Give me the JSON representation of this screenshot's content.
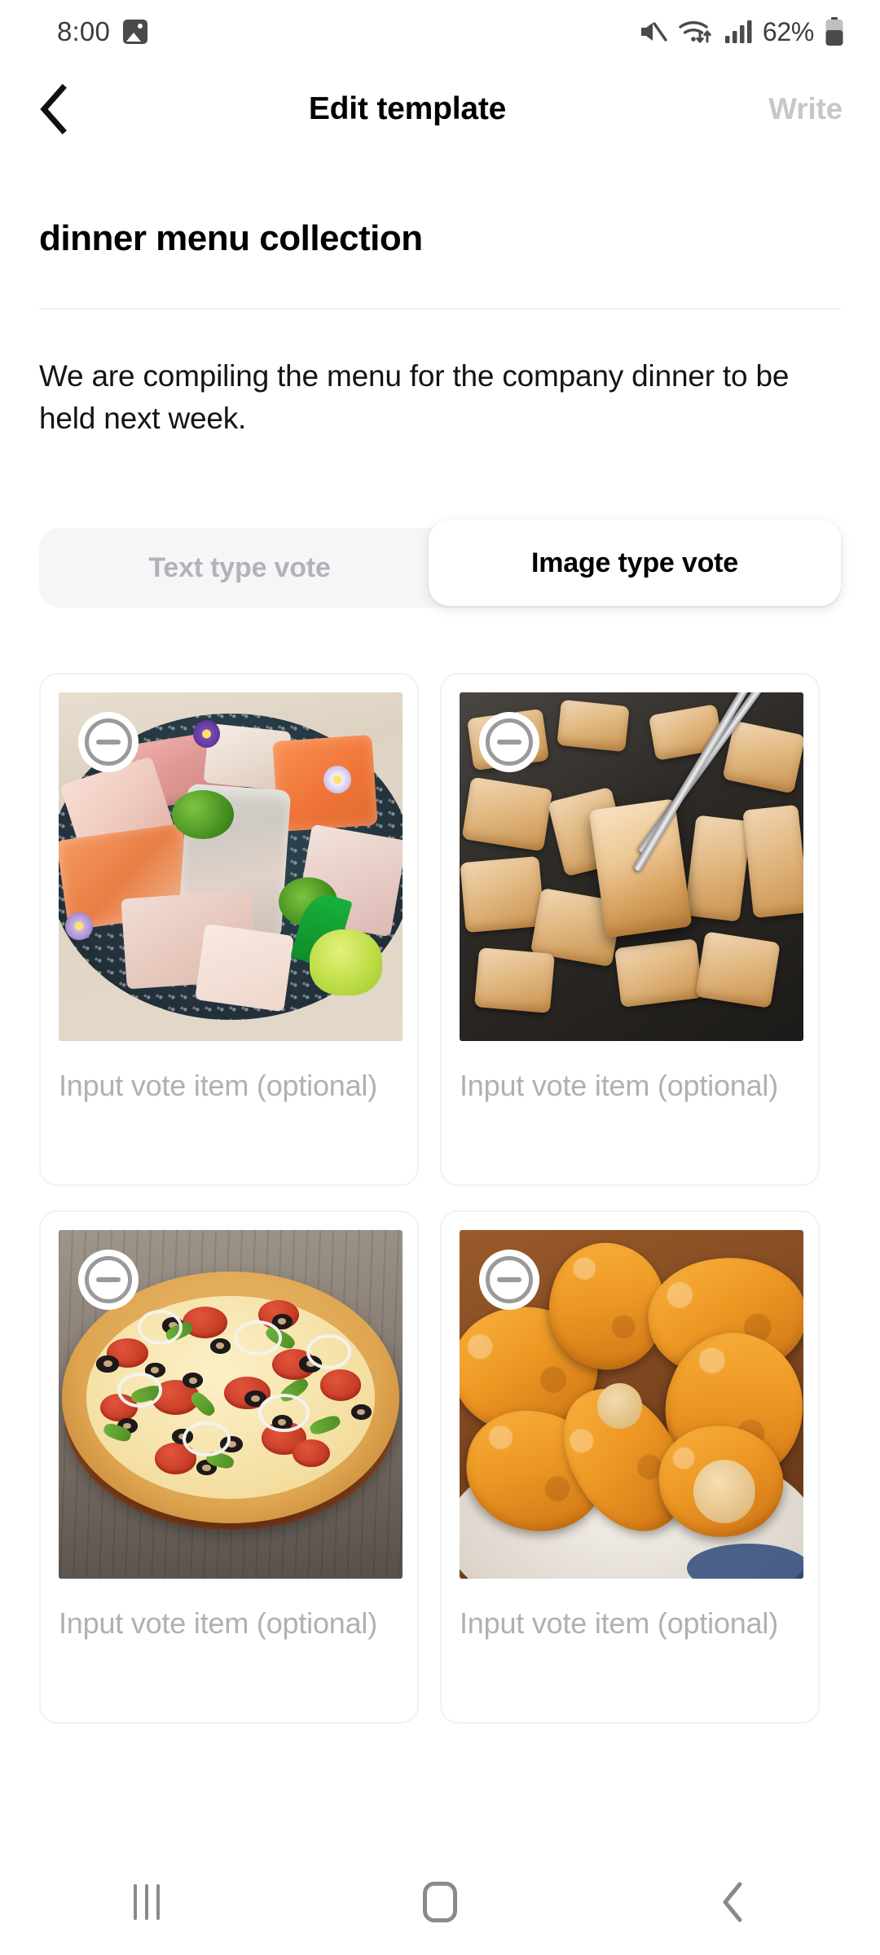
{
  "status_bar": {
    "time": "8:00",
    "image_notification_icon": "image-notification-icon",
    "mute_icon": "mute-icon",
    "wifi_icon": "wifi-transfer-icon",
    "signal_icon": "cellular-signal-icon",
    "battery_percent": "62%",
    "battery_icon": "battery-icon"
  },
  "header": {
    "back_icon": "chevron-left-icon",
    "title": "Edit template",
    "write_label": "Write"
  },
  "poll": {
    "title": "dinner menu collection",
    "description": "We are compiling the menu for the company dinner to be held next week."
  },
  "tabs": {
    "text_type": "Text type vote",
    "image_type": "Image type vote",
    "selected": "Image type vote"
  },
  "vote_items": [
    {
      "id": 1,
      "image_alt": "sashimi platter",
      "remove_icon": "minus-circle-icon",
      "placeholder": "Input vote item (optional)",
      "value": ""
    },
    {
      "id": 2,
      "image_alt": "grilled pork belly with chopsticks",
      "remove_icon": "minus-circle-icon",
      "placeholder": "Input vote item (optional)",
      "value": ""
    },
    {
      "id": 3,
      "image_alt": "pepperoni pizza on wooden board",
      "remove_icon": "minus-circle-icon",
      "placeholder": "Input vote item (optional)",
      "value": ""
    },
    {
      "id": 4,
      "image_alt": "fried chicken on plate",
      "remove_icon": "minus-circle-icon",
      "placeholder": "Input vote item (optional)",
      "value": ""
    }
  ],
  "nav_bar": {
    "recents_icon": "recents-icon",
    "home_icon": "home-icon",
    "back_icon": "back-icon"
  },
  "colors": {
    "accent_disabled": "#c7c7c9",
    "tab_track": "#f6f6f8",
    "placeholder_text": "#b0b0b4",
    "card_border": "#f2f2f4"
  }
}
